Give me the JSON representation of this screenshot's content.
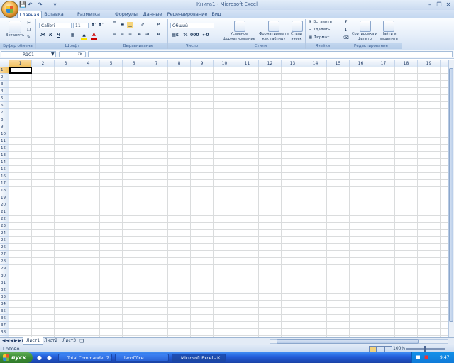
{
  "window": {
    "title": "Книга1 - Microsoft Excel"
  },
  "quick_access": [
    "save-icon",
    "undo-icon",
    "redo-icon",
    "customize-icon"
  ],
  "tabs": [
    "Главная",
    "Вставка",
    "Разметка страницы",
    "Формулы",
    "Данные",
    "Рецензирование",
    "Вид"
  ],
  "ribbon": {
    "clipboard": {
      "paste_label": "Вставить",
      "group_label": "Буфер обмена"
    },
    "font": {
      "font_name": "Calibri",
      "font_size": "11",
      "group_label": "Шрифт"
    },
    "alignment": {
      "group_label": "Выравнивание"
    },
    "number": {
      "format": "Общий",
      "group_label": "Число"
    },
    "styles": {
      "conditional": "Условное форматирование",
      "as_table": "Форматировать как таблицу",
      "cell_styles": "Стили ячеек",
      "group_label": "Стили"
    },
    "cells": {
      "insert": "Вставить",
      "delete": "Удалить",
      "format": "Формат",
      "group_label": "Ячейки"
    },
    "editing": {
      "sort": "Сортировка и фильтр",
      "find": "Найти и выделить",
      "group_label": "Редактирование"
    }
  },
  "formula_bar": {
    "name_box": "R1C1",
    "fx": "fx",
    "value": ""
  },
  "columns": [
    "1",
    "2",
    "3",
    "4",
    "5",
    "6",
    "7",
    "8",
    "9",
    "10",
    "11",
    "12",
    "13",
    "14",
    "15",
    "16",
    "17",
    "18",
    "19"
  ],
  "rows": [
    "1",
    "2",
    "3",
    "4",
    "5",
    "6",
    "7",
    "8",
    "9",
    "10",
    "11",
    "12",
    "13",
    "14",
    "15",
    "16",
    "17",
    "18",
    "19",
    "20",
    "21",
    "22",
    "23",
    "24",
    "25",
    "26",
    "27",
    "28",
    "29",
    "30",
    "31",
    "32",
    "33",
    "34",
    "35",
    "36",
    "37",
    "38"
  ],
  "sheets": [
    "Лист1",
    "Лист2",
    "Лист3"
  ],
  "status": {
    "text": "Готово",
    "zoom": "100%"
  },
  "taskbar": {
    "start": "пуск",
    "tasks": [
      "Total Commander 7.0...",
      "leoofffice",
      "Microsoft Excel - К..."
    ],
    "clock": "9:47"
  }
}
